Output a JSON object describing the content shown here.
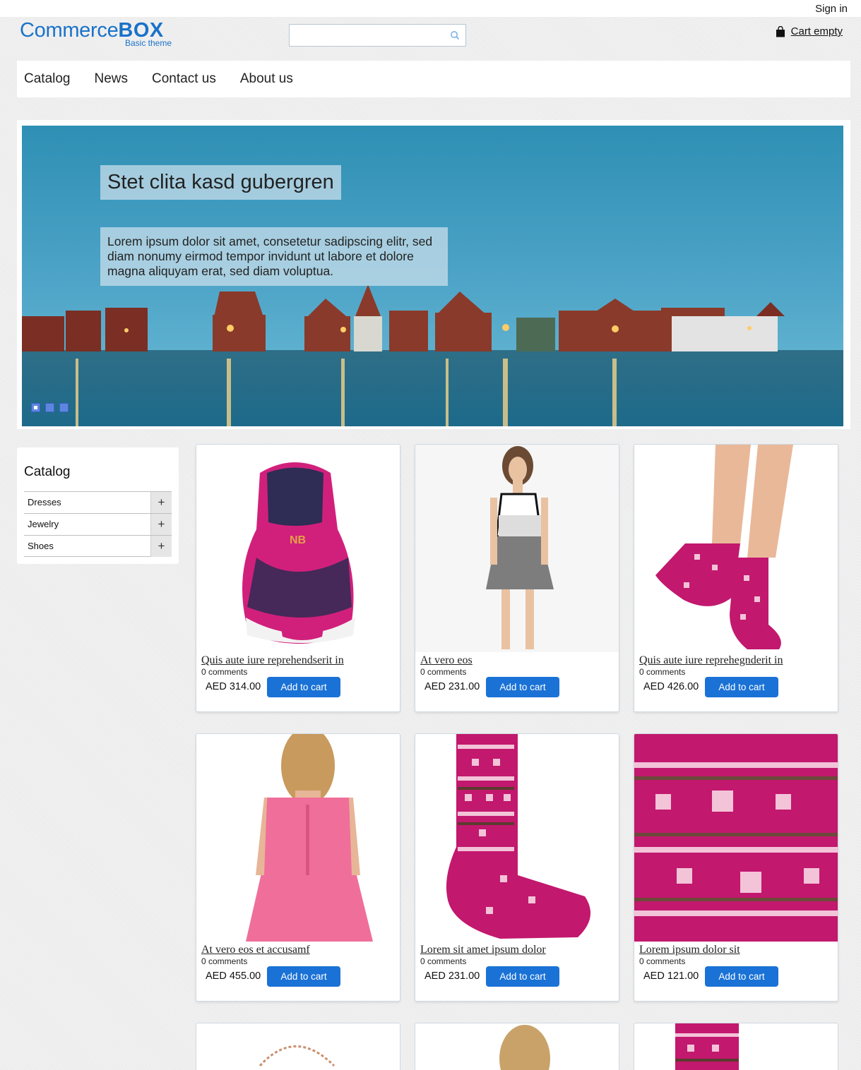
{
  "header": {
    "sign_in": "Sign in",
    "logo_main": "Commerce",
    "logo_bold": "BOX",
    "logo_sub": "Basic theme",
    "search_placeholder": "",
    "cart_label": "Cart empty"
  },
  "nav": {
    "items": [
      "Catalog",
      "News",
      "Contact us",
      "About us"
    ]
  },
  "slider": {
    "title": "Stet clita kasd gubergren",
    "text": "Lorem ipsum dolor sit amet, consetetur sadipscing elitr, sed diam nonumy eirmod tempor invidunt ut labore et dolore magna aliquyam erat, sed diam voluptua.",
    "dots_count": 3,
    "active_dot": 1
  },
  "sidebar": {
    "title": "Catalog",
    "items": [
      {
        "label": "Dresses",
        "expand": "+"
      },
      {
        "label": "Jewelry",
        "expand": "+"
      },
      {
        "label": "Shoes",
        "expand": "+"
      }
    ]
  },
  "products": [
    {
      "title": "Quis aute iure reprehendserit in",
      "comments": "0 comments",
      "price": "AED 314.00",
      "button": "Add to cart",
      "image": "pink-sneaker"
    },
    {
      "title": "At vero eos",
      "comments": "0 comments",
      "price": "AED 231.00",
      "button": "Add to cart",
      "image": "plaid-dress-model"
    },
    {
      "title": "Quis aute iure reprehegnderit in",
      "comments": "0 comments",
      "price": "AED 426.00",
      "button": "Add to cart",
      "image": "pink-socks-legs"
    },
    {
      "title": "At vero eos et accusamf",
      "comments": "0 comments",
      "price": "AED 455.00",
      "button": "Add to cart",
      "image": "pink-dress-back"
    },
    {
      "title": "Lorem sit amet ipsum dolor",
      "comments": "0 comments",
      "price": "AED 231.00",
      "button": "Add to cart",
      "image": "pink-knit-sock"
    },
    {
      "title": "Lorem ipsum dolor sit",
      "comments": "0 comments",
      "price": "AED 121.00",
      "button": "Add to cart",
      "image": "pink-knit-closeup"
    }
  ],
  "colors": {
    "brand": "#1a72c9",
    "button": "#1a72d6",
    "slider_dot": "#5e86e0",
    "product_pink": "#c2186e"
  }
}
